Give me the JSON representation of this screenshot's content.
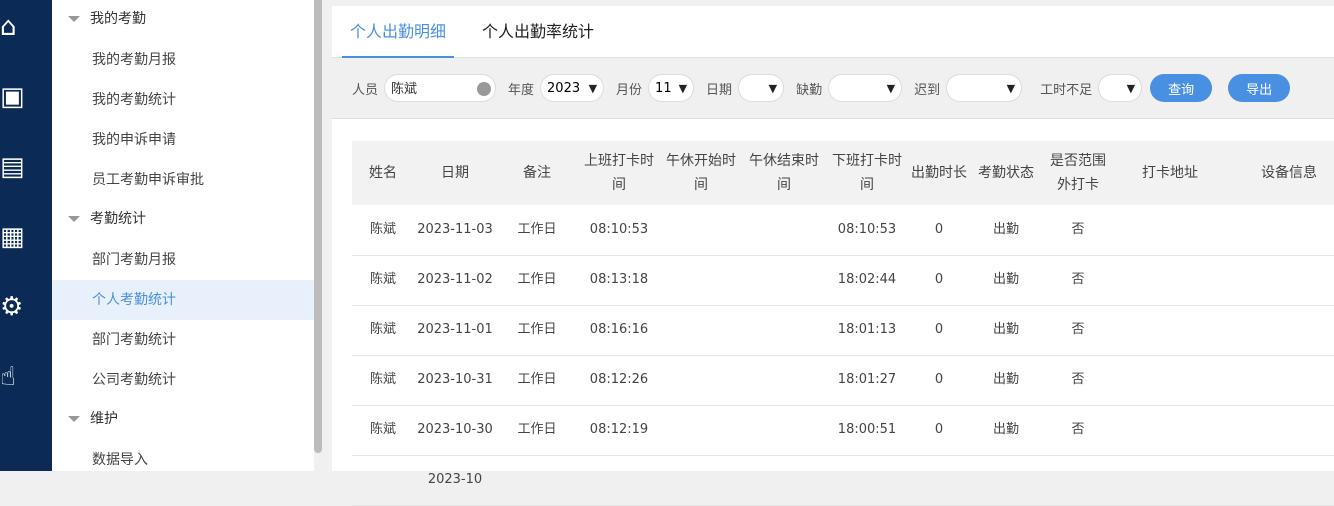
{
  "iconbar": [
    "home-icon",
    "user-monitor-icon",
    "report-icon",
    "calendar-icon",
    "user-settings-icon",
    "touch-icon"
  ],
  "sidebar": {
    "groups": [
      {
        "label": "我的考勤",
        "items": [
          "我的考勤月报",
          "我的考勤统计",
          "我的申诉申请",
          "员工考勤申诉审批"
        ]
      },
      {
        "label": "考勤统计",
        "items": [
          "部门考勤月报",
          "个人考勤统计",
          "部门考勤统计",
          "公司考勤统计"
        ]
      },
      {
        "label": "维护",
        "items": [
          "数据导入"
        ]
      }
    ],
    "active": "个人考勤统计"
  },
  "tabs": [
    "个人出勤明细",
    "个人出勤率统计"
  ],
  "filters": {
    "person_label": "人员",
    "person_value": "陈斌",
    "year_label": "年度",
    "year_value": "2023",
    "month_label": "月份",
    "month_value": "11",
    "date_label": "日期",
    "absent_label": "缺勤",
    "late_label": "迟到",
    "short_label": "工时不足",
    "query": "查询",
    "export": "导出"
  },
  "table": {
    "headers": [
      "姓名",
      "日期",
      "备注",
      "上班打卡时间",
      "午休开始时间",
      "午休结束时间",
      "下班打卡时间",
      "出勤时长",
      "考勤状态",
      "是否范围外打卡",
      "打卡地址",
      "设备信息"
    ],
    "rows": [
      [
        "陈斌",
        "2023-11-03",
        "工作日",
        "08:10:53",
        "",
        "",
        "08:10:53",
        "0",
        "出勤",
        "否",
        "",
        ""
      ],
      [
        "陈斌",
        "2023-11-02",
        "工作日",
        "08:13:18",
        "",
        "",
        "18:02:44",
        "0",
        "出勤",
        "否",
        "",
        ""
      ],
      [
        "陈斌",
        "2023-11-01",
        "工作日",
        "08:16:16",
        "",
        "",
        "18:01:13",
        "0",
        "出勤",
        "否",
        "",
        ""
      ],
      [
        "陈斌",
        "2023-10-31",
        "工作日",
        "08:12:26",
        "",
        "",
        "18:01:27",
        "0",
        "出勤",
        "否",
        "",
        ""
      ],
      [
        "陈斌",
        "2023-10-30",
        "工作日",
        "08:12:19",
        "",
        "",
        "18:00:51",
        "0",
        "出勤",
        "否",
        "",
        ""
      ],
      [
        "",
        "2023-10",
        "",
        "",
        "",
        "",
        "",
        "",
        "",
        "",
        "",
        ""
      ]
    ]
  }
}
